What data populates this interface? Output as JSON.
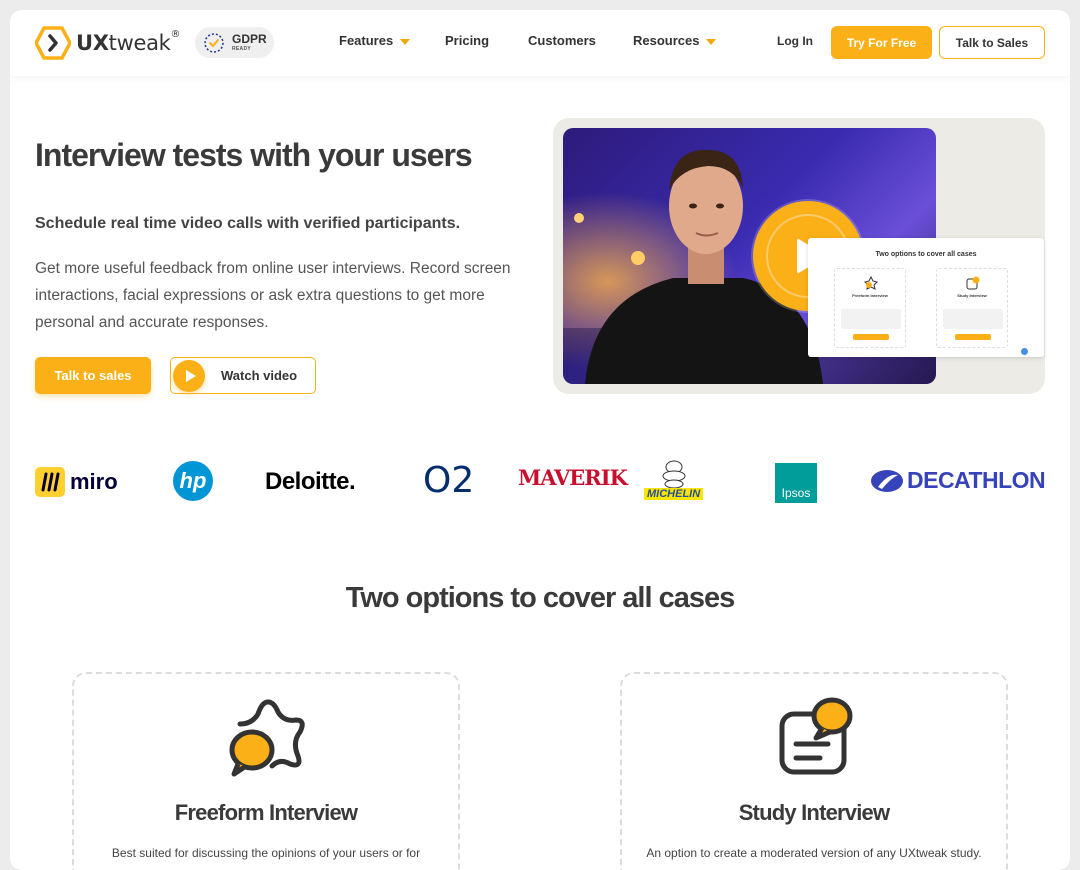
{
  "header": {
    "logo_text_bold": "UX",
    "logo_text_rest": "tweak",
    "logo_reg": "®",
    "gdpr_title": "GDPR",
    "gdpr_sub": "READY",
    "nav": [
      "Features",
      "Pricing",
      "Customers",
      "Resources"
    ],
    "login": "Log In",
    "try_free": "Try For Free",
    "talk_sales": "Talk to Sales"
  },
  "hero": {
    "title": "Interview tests with your users",
    "subtitle": "Schedule real time video calls with verified participants.",
    "description": "Get more useful feedback from online user interviews. Record screen interactions, facial expressions or ask extra questions to get more personal and accurate responses.",
    "talk_button": "Talk to sales",
    "watch_button": "Watch video",
    "mini_title": "Two options to cover all cases",
    "mini_card_1": "Freeform Interview",
    "mini_card_2": "Study Interview"
  },
  "logos": [
    "miro",
    "hp",
    "Deloitte.",
    "O2",
    "MAVERIK",
    "MICHELIN",
    "Ipsos",
    "DECATHLON"
  ],
  "options": {
    "title": "Two options to cover all cases",
    "cards": [
      {
        "title": "Freeform Interview",
        "desc": "Best suited for discussing the opinions of your users or for"
      },
      {
        "title": "Study Interview",
        "desc": "An option to create a moderated version of any UXtweak study."
      }
    ]
  },
  "colors": {
    "accent": "#fbb017",
    "text": "#3a3a3a"
  }
}
